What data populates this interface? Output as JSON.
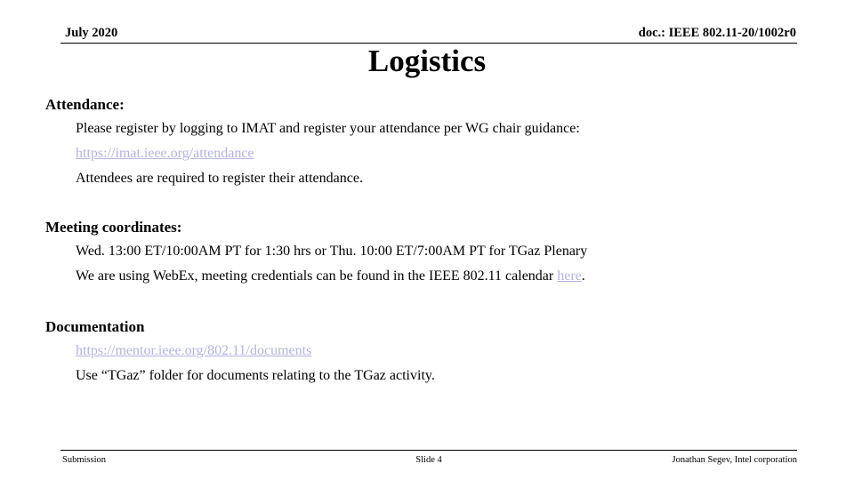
{
  "header": {
    "date": "July 2020",
    "doc_number": "doc.: IEEE 802.11-20/1002r0"
  },
  "title": "Logistics",
  "sections": [
    {
      "heading": "Attendance:",
      "lines": [
        {
          "text": "Please register by logging to IMAT and register your attendance per WG chair guidance:",
          "type": "text"
        },
        {
          "text": "https://imat.ieee.org/attendance",
          "type": "link"
        },
        {
          "text": "Attendees are required to register their attendance.",
          "type": "text"
        }
      ]
    },
    {
      "heading": "Meeting coordinates:",
      "lines": [
        {
          "text": "Wed. 13:00 ET/10:00AM PT for 1:30 hrs or Thu. 10:00 ET/7:00AM PT for TGaz Plenary",
          "type": "text"
        },
        {
          "text": "We are using WebEx, meeting credentials can be found in the IEEE 802.11 calendar ",
          "type": "text-with-link",
          "link_text": "here",
          "tail": "."
        }
      ]
    },
    {
      "heading": "Documentation",
      "lines": [
        {
          "text": "https://mentor.ieee.org/802.11/documents",
          "type": "link"
        },
        {
          "text": "Use “TGaz” folder for documents relating to the TGaz activity.",
          "type": "text"
        }
      ]
    }
  ],
  "footer": {
    "left": "Submission",
    "center": "Slide 4",
    "right": "Jonathan Segev, Intel corporation"
  },
  "colors": {
    "link": "#b3b3e0",
    "text": "#000000",
    "background": "#ffffff"
  }
}
